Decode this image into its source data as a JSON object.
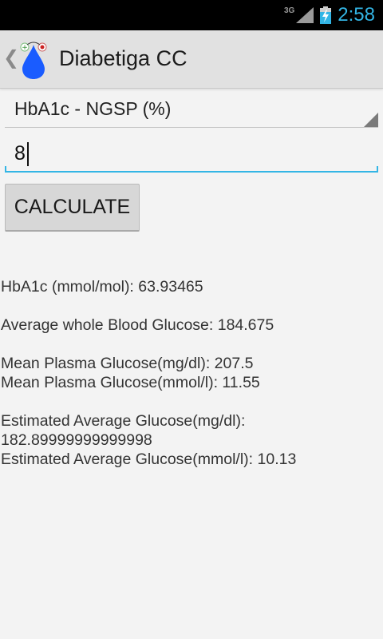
{
  "status_bar": {
    "network": "3G",
    "time": "2:58"
  },
  "app_bar": {
    "title": "Diabetiga CC"
  },
  "converter": {
    "unit_selected": "HbA1c - NGSP (%)",
    "input_value": "8",
    "calculate_label": "CALCULATE"
  },
  "results": {
    "hba1c_mmol": "HbA1c (mmol/mol): 63.93465",
    "whole_blood": "Average whole Blood Glucose: 184.675",
    "plasma_mgdl": "Mean Plasma Glucose(mg/dl): 207.5",
    "plasma_mmol": "Mean Plasma Glucose(mmol/l): 11.55",
    "eag_mgdl_label": "Estimated Average Glucose(mg/dl):",
    "eag_mgdl_value": "182.89999999999998",
    "eag_mmol": "Estimated Average Glucose(mmol/l): 10.13"
  }
}
